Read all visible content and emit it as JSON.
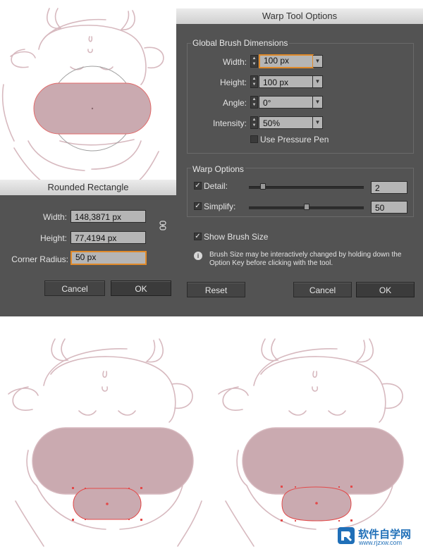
{
  "rounded_rectangle": {
    "title": "Rounded Rectangle",
    "width_label": "Width:",
    "width_value": "148,3871 px",
    "height_label": "Height:",
    "height_value": "77,4194 px",
    "corner_label": "Corner Radius:",
    "corner_value": "50 px",
    "cancel": "Cancel",
    "ok": "OK"
  },
  "warp": {
    "title": "Warp Tool Options",
    "global_group": "Global Brush Dimensions",
    "width_label": "Width:",
    "width_value": "100 px",
    "height_label": "Height:",
    "height_value": "100 px",
    "angle_label": "Angle:",
    "angle_value": "0°",
    "intensity_label": "Intensity:",
    "intensity_value": "50%",
    "pressure_label": "Use Pressure Pen",
    "pressure_checked": false,
    "warp_group": "Warp Options",
    "detail_label": "Detail:",
    "detail_value": "2",
    "detail_checked": true,
    "simplify_label": "Simplify:",
    "simplify_value": "50",
    "simplify_checked": true,
    "show_brush_label": "Show Brush Size",
    "show_brush_checked": true,
    "info_text": "Brush Size may be interactively changed by holding down the Option Key before clicking with the tool.",
    "reset": "Reset",
    "cancel": "Cancel",
    "ok": "OK"
  },
  "watermark": {
    "brand": "软件自学网",
    "url": "www.rjzxw.com"
  },
  "colors": {
    "dialog_bg": "#535353",
    "sketch_line": "#d7b9bf",
    "shape_fill": "#caaab0",
    "selection": "#e24a4a",
    "focus_ring": "#e08a2a"
  }
}
